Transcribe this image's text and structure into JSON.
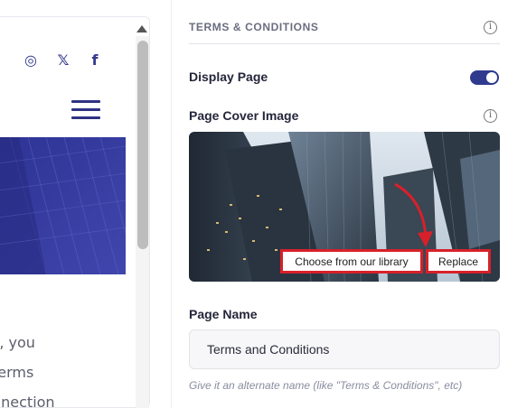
{
  "preview": {
    "social_icons": [
      "instagram-icon",
      "x-twitter-icon",
      "facebook-icon"
    ],
    "social_glyphs": {
      "instagram": "◎",
      "x": "𝕏",
      "facebook": "f"
    },
    "body_lines": [
      "s, you",
      "terms",
      "nnection"
    ]
  },
  "settings": {
    "section_title": "TERMS & CONDITIONS",
    "info_glyph": "i",
    "display_page": {
      "label": "Display Page",
      "enabled": true
    },
    "cover_image": {
      "label": "Page Cover Image",
      "choose_library_label": "Choose from our library",
      "replace_label": "Replace"
    },
    "page_name": {
      "label": "Page Name",
      "value": "Terms and Conditions",
      "helper": "Give it an alternate name (like \"Terms & Conditions\", etc)"
    }
  },
  "colors": {
    "accent": "#2f3a8f",
    "highlight": "#d8202a",
    "hero": "#3d43a8"
  }
}
